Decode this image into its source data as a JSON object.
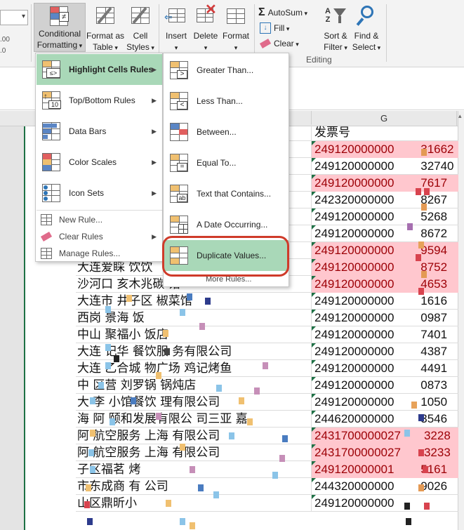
{
  "ribbon": {
    "conditional_formatting": "Conditional",
    "conditional_formatting_2": "Formatting",
    "format_as_table": "Format as",
    "format_as_table_2": "Table",
    "cell_styles": "Cell",
    "cell_styles_2": "Styles",
    "insert": "Insert",
    "delete": "Delete",
    "format": "Format",
    "autosum": "AutoSum",
    "fill": "Fill",
    "clear": "Clear",
    "sort_filter": "Sort &",
    "sort_filter_2": "Filter",
    "find_select": "Find &",
    "find_select_2": "Select",
    "group_editing": "Editing"
  },
  "sheet": {
    "column_g": "G",
    "rows": [
      {
        "f": "",
        "g": "发票号",
        "header": true
      },
      {
        "f": "",
        "g": "249120000000        31662",
        "dup": true
      },
      {
        "f": "",
        "g": "249120000000        32740",
        "dup": false
      },
      {
        "f": "",
        "g": "249120000000        7617",
        "dup": true
      },
      {
        "f": "",
        "g": "242320000000        8267",
        "dup": false
      },
      {
        "f": "",
        "g": "249120000000        5268",
        "dup": false
      },
      {
        "f": "",
        "g": "249120000000        8672",
        "dup": false
      },
      {
        "f": "",
        "g": "249120000000        9594",
        "dup": true
      },
      {
        "f": "大连爱睬 饮饮",
        "g": "249120000000        8752",
        "dup": true
      },
      {
        "f": "沙河口  亥木兆碳   馆",
        "g": "249120000000        4653",
        "dup": true
      },
      {
        "f": "大连市  井子区    椒菜馆",
        "g": "249120000000        1616",
        "dup": false
      },
      {
        "f": "西岗  景海  饭",
        "g": "249120000000        0987",
        "dup": false
      },
      {
        "f": "中山  聚福小  饭店",
        "g": "249120000000        7401",
        "dup": false
      },
      {
        "f": "大连  记华  餐饮服  务有限公司",
        "g": "249120000000        4387",
        "dup": false
      },
      {
        "f": "大连  乙合城  物广场  鸡记烤鱼",
        "g": "249120000000        4491",
        "dup": false
      },
      {
        "f": "中  区营  刘罗锅  锅炖店",
        "g": "249120000000        0873",
        "dup": false
      },
      {
        "f": "大  李  小馆餐饮  理有限公司",
        "g": "249120000000        1050",
        "dup": false
      },
      {
        "f": "海  阿  颐和发展有限公  司三亚  嘉",
        "g": "244620000000        3546",
        "dup": false
      },
      {
        "f": "阿  航空服务  上海  有限公司",
        "g": "2431700000027       3228",
        "dup": true
      },
      {
        "f": "阿  航空服务  上海  有限公司",
        "g": "2431700000027       3233",
        "dup": true
      },
      {
        "f": "  子区福茗  烤",
        "g": "249120000001        5161",
        "dup": true
      },
      {
        "f": "  市东成商  有  公司",
        "g": "244320000000        9026",
        "dup": false
      },
      {
        "f": "  山区鼎昕小",
        "g": "249120000000",
        "dup": false
      }
    ]
  },
  "menu_main": {
    "highlight": "Highlight Cells Rules",
    "topbottom": "Top/Bottom Rules",
    "databars": "Data Bars",
    "colorscales": "Color Scales",
    "iconsets": "Icon Sets",
    "new_rule": "New Rule...",
    "clear_rules": "Clear Rules",
    "manage_rules": "Manage Rules..."
  },
  "menu_sub": {
    "greater": "Greater Than...",
    "less": "Less Than...",
    "between": "Between...",
    "equal": "Equal To...",
    "text_contains": "Text that Contains...",
    "date_occurring": "A Date Occurring...",
    "duplicate": "Duplicate Values...",
    "more_rules": "More Rules..."
  },
  "colors": {
    "duplicate_fill": "#ffc7ce",
    "menu_highlight": "#a9d8b8",
    "callout": "#cf3b2a"
  }
}
